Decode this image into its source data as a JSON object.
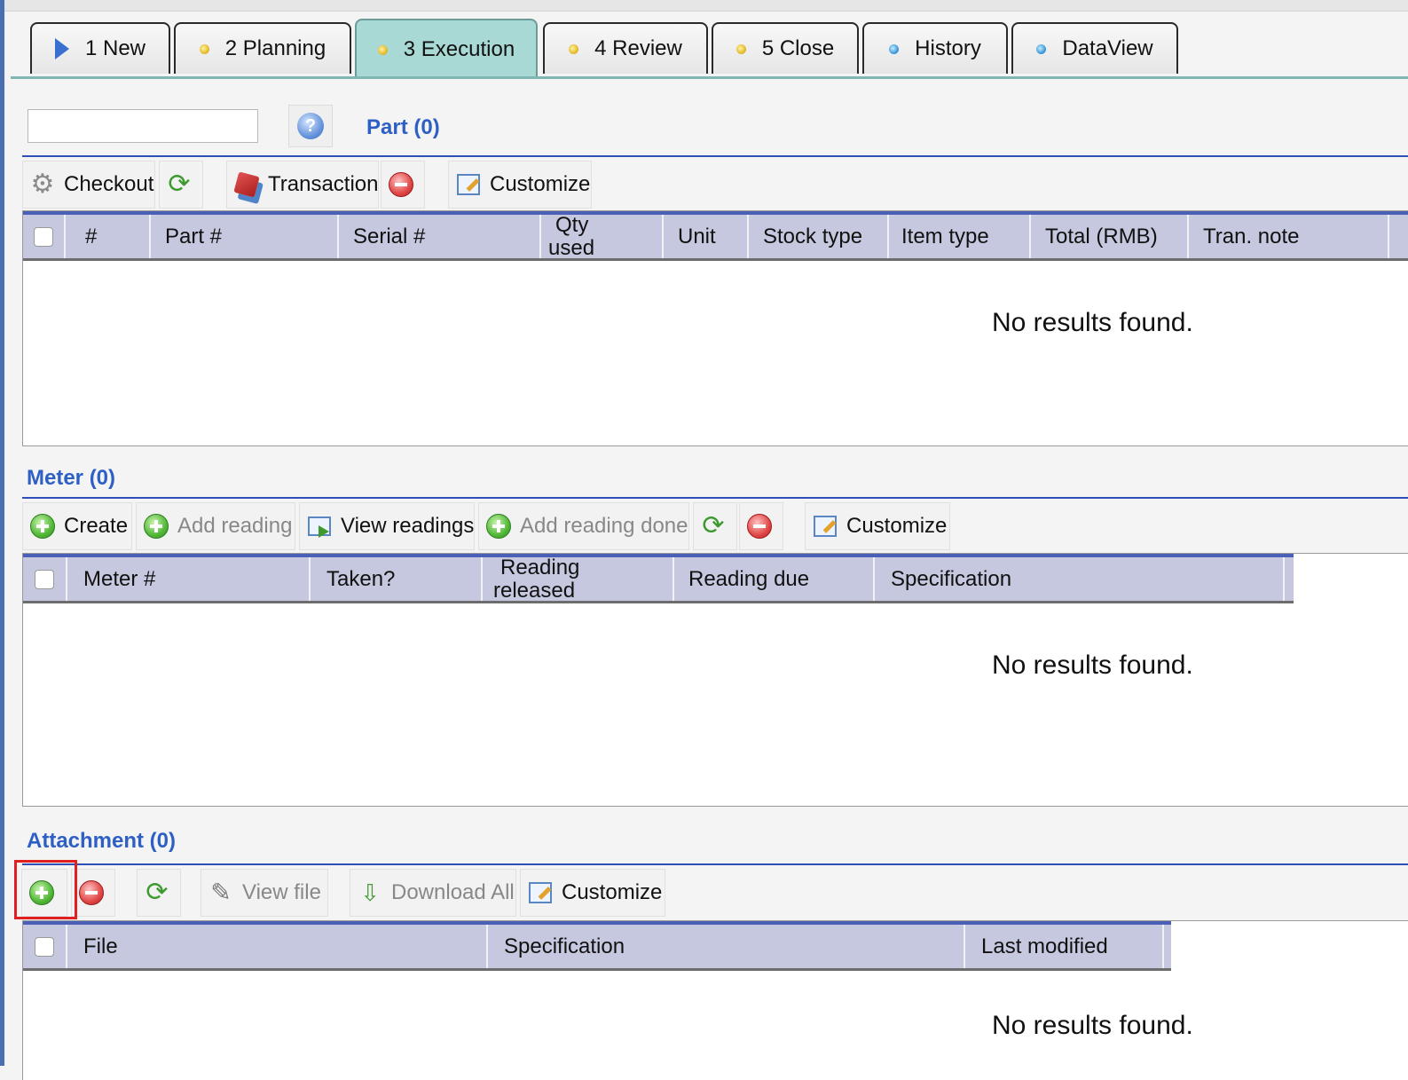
{
  "tabs": [
    {
      "label": "1 New",
      "icon": "play-icon"
    },
    {
      "label": "2 Planning",
      "icon": "yellow-dot-icon"
    },
    {
      "label": "3 Execution",
      "icon": "yellow-dot-icon",
      "active": true
    },
    {
      "label": "4 Review",
      "icon": "yellow-dot-icon"
    },
    {
      "label": "5 Close",
      "icon": "yellow-dot-icon"
    },
    {
      "label": "History",
      "icon": "blue-dot-icon"
    },
    {
      "label": "DataView",
      "icon": "blue-dot-icon"
    }
  ],
  "search": {
    "value": "",
    "placeholder": ""
  },
  "part": {
    "title": "Part (0)",
    "toolbar": {
      "checkout": "Checkout",
      "transaction": "Transaction",
      "customize": "Customize"
    },
    "columns": [
      "#",
      "Part #",
      "Serial #",
      "Qty used",
      "Unit",
      "Stock type",
      "Item type",
      "Total (RMB)",
      "Tran. note"
    ],
    "qty_used_line1": "Qty",
    "qty_used_line2": "used",
    "empty_text": "No results found."
  },
  "meter": {
    "title": "Meter (0)",
    "toolbar": {
      "create": "Create",
      "add_reading": "Add reading",
      "view_readings": "View readings",
      "add_reading_done": "Add reading done",
      "customize": "Customize"
    },
    "columns": [
      "Meter #",
      "Taken?",
      "Reading released",
      "Reading due",
      "Specification"
    ],
    "reading_released_line1": "Reading",
    "reading_released_line2": "released",
    "empty_text": "No results found."
  },
  "attachment": {
    "title": "Attachment (0)",
    "toolbar": {
      "view_file": "View file",
      "download_all": "Download All",
      "customize": "Customize"
    },
    "columns": [
      "File",
      "Specification",
      "Last modified"
    ],
    "empty_text": "No results found."
  },
  "colors": {
    "accent_blue": "#2d5fc4",
    "active_tab": "#a9d9d4",
    "grid_header": "#c5c8de",
    "highlight": "#e02020"
  }
}
